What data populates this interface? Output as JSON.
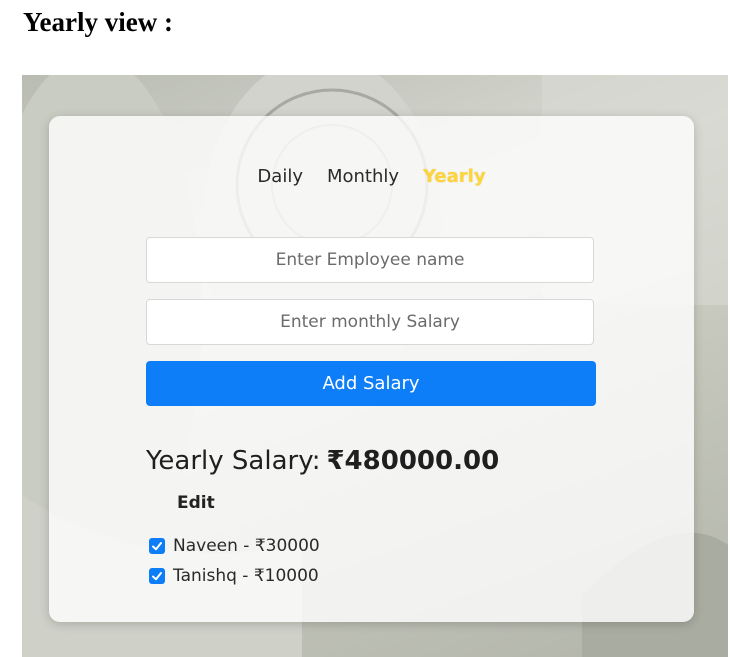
{
  "doc_heading": "Yearly view :",
  "tabs": [
    {
      "label": "Daily",
      "active": false
    },
    {
      "label": "Monthly",
      "active": false
    },
    {
      "label": "Yearly",
      "active": true
    }
  ],
  "form": {
    "name_placeholder": "Enter Employee name",
    "salary_placeholder": "Enter monthly Salary",
    "add_label": "Add Salary"
  },
  "summary": {
    "label": "Yearly Salary:",
    "amount": "₹480000.00"
  },
  "edit_label": "Edit",
  "employees": [
    {
      "text": "Naveen - ₹30000",
      "checked": true
    },
    {
      "text": "Tanishq - ₹10000",
      "checked": true
    }
  ],
  "colors": {
    "accent": "#0d7ef8",
    "active_tab": "#ffd43b"
  },
  "background_image": "dollar-bills-photo"
}
